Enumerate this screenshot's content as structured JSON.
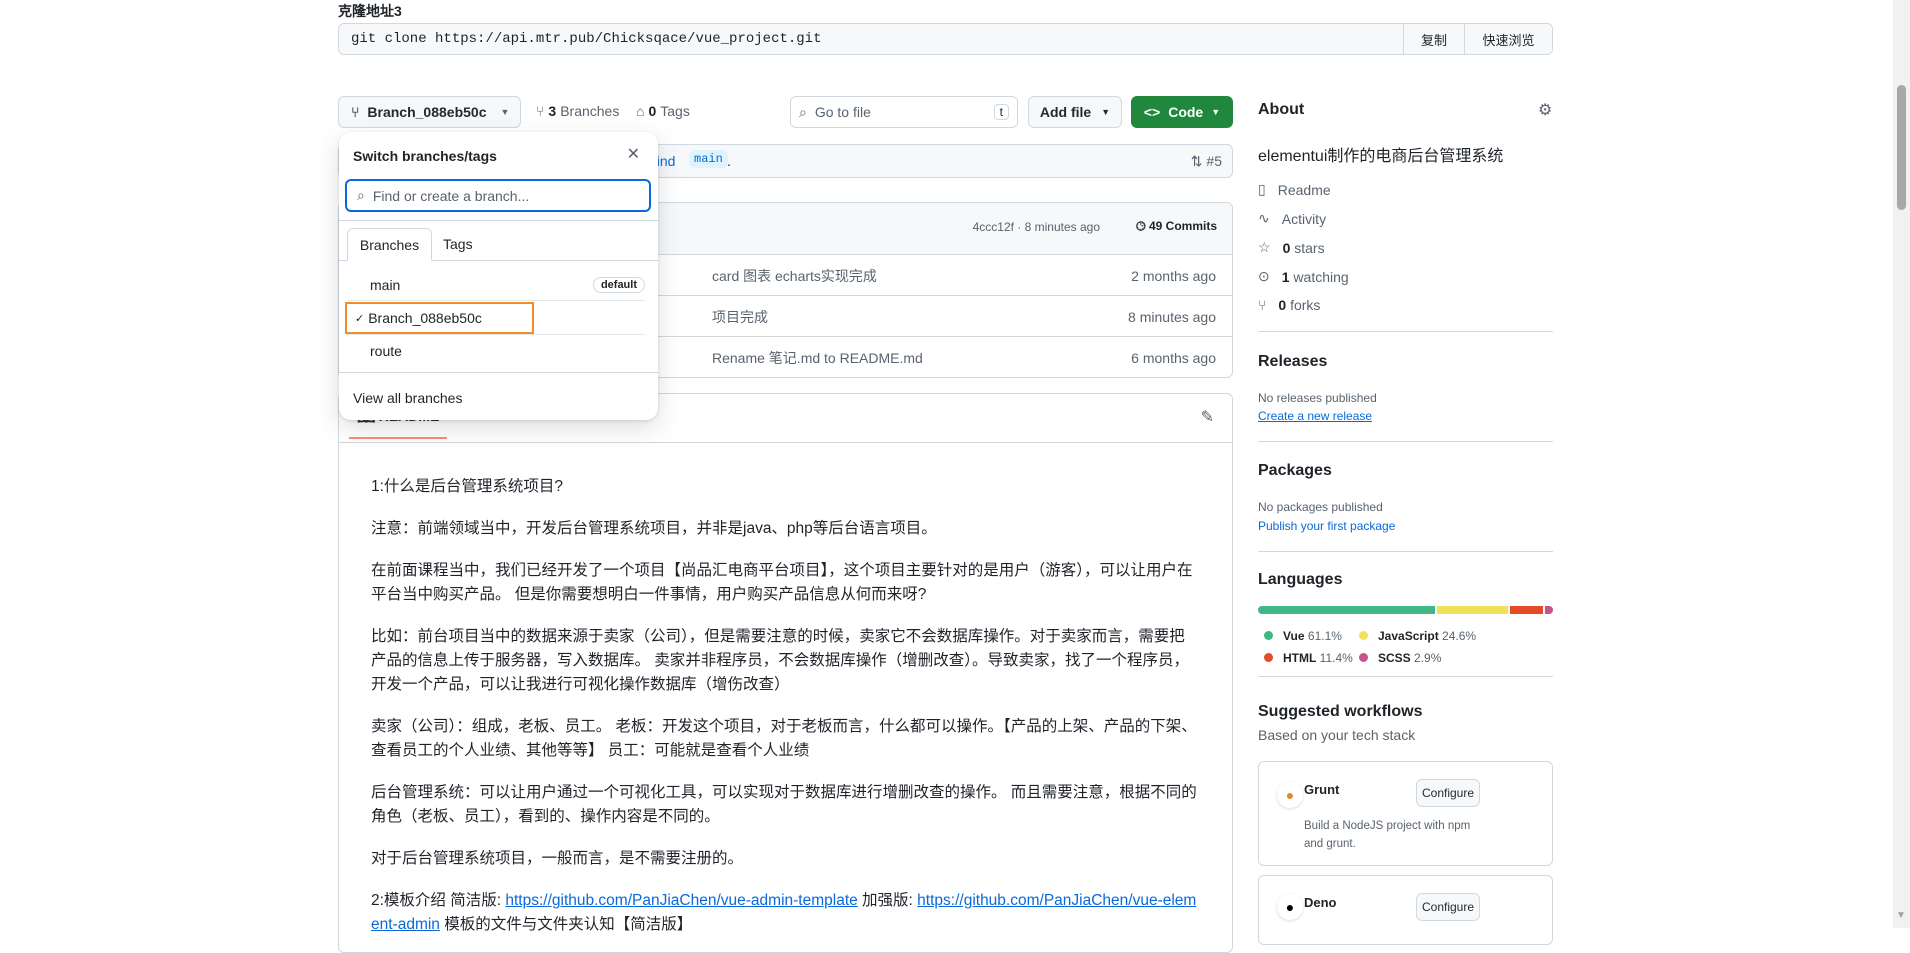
{
  "clone": {
    "title": "克隆地址3",
    "command": "git clone https://api.mtr.pub/Chicksqace/vue_project.git",
    "copy": "复制",
    "quick_browse": "快速浏览"
  },
  "toolbar": {
    "branch": "Branch_088eb50c",
    "branches_count": "3",
    "branches_label": "Branches",
    "tags_count": "0",
    "tags_label": "Tags",
    "goto_placeholder": "Go to file",
    "goto_key": "t",
    "add_file": "Add file",
    "code": "Code"
  },
  "banner": {
    "text_tail": "hind",
    "branch_chip": "main",
    "period": ".",
    "pr": "#5"
  },
  "commits": {
    "meta": "4ccc12f · 8 minutes ago",
    "count": "49 Commits",
    "rows": [
      {
        "message": "card 图表 echarts实现完成",
        "time": "2 months ago"
      },
      {
        "message": "项目完成",
        "time": "8 minutes ago"
      },
      {
        "message": "Rename 笔记.md to README.md",
        "time": "6 months ago"
      }
    ]
  },
  "dropdown": {
    "title": "Switch branches/tags",
    "placeholder": "Find or create a branch...",
    "tabs": [
      "Branches",
      "Tags"
    ],
    "branches": [
      {
        "name": "main",
        "badge": "default"
      },
      {
        "name": "Branch_088eb50c",
        "check": "✓"
      },
      {
        "name": "route"
      }
    ],
    "view_all": "View all branches"
  },
  "readme": {
    "tab": "README",
    "paragraphs": [
      "1:什么是后台管理系统项目?",
      "注意：前端领域当中，开发后台管理系统项目，并非是java、php等后台语言项目。",
      "在前面课程当中，我们已经开发了一个项目【尚品汇电商平台项目】，这个项目主要针对的是用户（游客），可以让用户在平台当中购买产品。 但是你需要想明白一件事情，用户购买产品信息从何而来呀?",
      "比如：前台项目当中的数据来源于卖家（公司），但是需要注意的时候，卖家它不会数据库操作。对于卖家而言，需要把产品的信息上传于服务器，写入数据库。 卖家并非程序员，不会数据库操作（增删改查）。导致卖家，找了一个程序员，开发一个产品，可以让我进行可视化操作数据库（增伤改查）",
      "卖家（公司）：组成，老板、员工。 老板：开发这个项目，对于老板而言，什么都可以操作。【产品的上架、产品的下架、查看员工的个人业绩、其他等等】 员工：可能就是查看个人业绩",
      "后台管理系统：可以让用户通过一个可视化工具，可以实现对于数据库进行增删改查的操作。 而且需要注意，根据不同的角色（老板、员工），看到的、操作内容是不同的。",
      "对于后台管理系统项目，一般而言，是不需要注册的。"
    ],
    "last": {
      "prefix": "2:模板介绍 简洁版: ",
      "link1": "https://github.com/PanJiaChen/vue-admin-template",
      "mid": " 加强版: ",
      "link2": "https://github.com/PanJiaChen/vue-element-admin",
      "suffix": " 模板的文件与文件夹认知【简洁版】"
    }
  },
  "about": {
    "title": "About",
    "description": "elementui制作的电商后台管理系统",
    "items": [
      {
        "icon": "book-icon",
        "label": "Readme"
      },
      {
        "icon": "pulse-icon",
        "label": "Activity"
      },
      {
        "icon": "star-icon",
        "count": "0",
        "label": "stars"
      },
      {
        "icon": "eye-icon",
        "count": "1",
        "label": "watching"
      },
      {
        "icon": "fork-icon",
        "count": "0",
        "label": "forks"
      }
    ]
  },
  "releases": {
    "title": "Releases",
    "empty": "No releases published",
    "link": "Create a new release"
  },
  "packages": {
    "title": "Packages",
    "empty": "No packages published",
    "link": "Publish your first package"
  },
  "languages": {
    "title": "Languages",
    "items": [
      {
        "name": "Vue",
        "percent": "61.1%",
        "value": 61.1,
        "color": "#41b883"
      },
      {
        "name": "JavaScript",
        "percent": "24.6%",
        "value": 24.6,
        "color": "#f1e05a"
      },
      {
        "name": "HTML",
        "percent": "11.4%",
        "value": 11.4,
        "color": "#e34c26"
      },
      {
        "name": "SCSS",
        "percent": "2.9%",
        "value": 2.9,
        "color": "#c6538c"
      }
    ]
  },
  "workflows": {
    "title": "Suggested workflows",
    "subtitle": "Based on your tech stack",
    "items": [
      {
        "name": "Grunt",
        "desc": "Build a NodeJS project with npm and grunt.",
        "button": "Configure"
      },
      {
        "name": "Deno",
        "button": "Configure"
      }
    ]
  },
  "colors": {
    "accent": "#0969da",
    "code_button": "#1f883d",
    "highlight_border": "#f28c28"
  }
}
